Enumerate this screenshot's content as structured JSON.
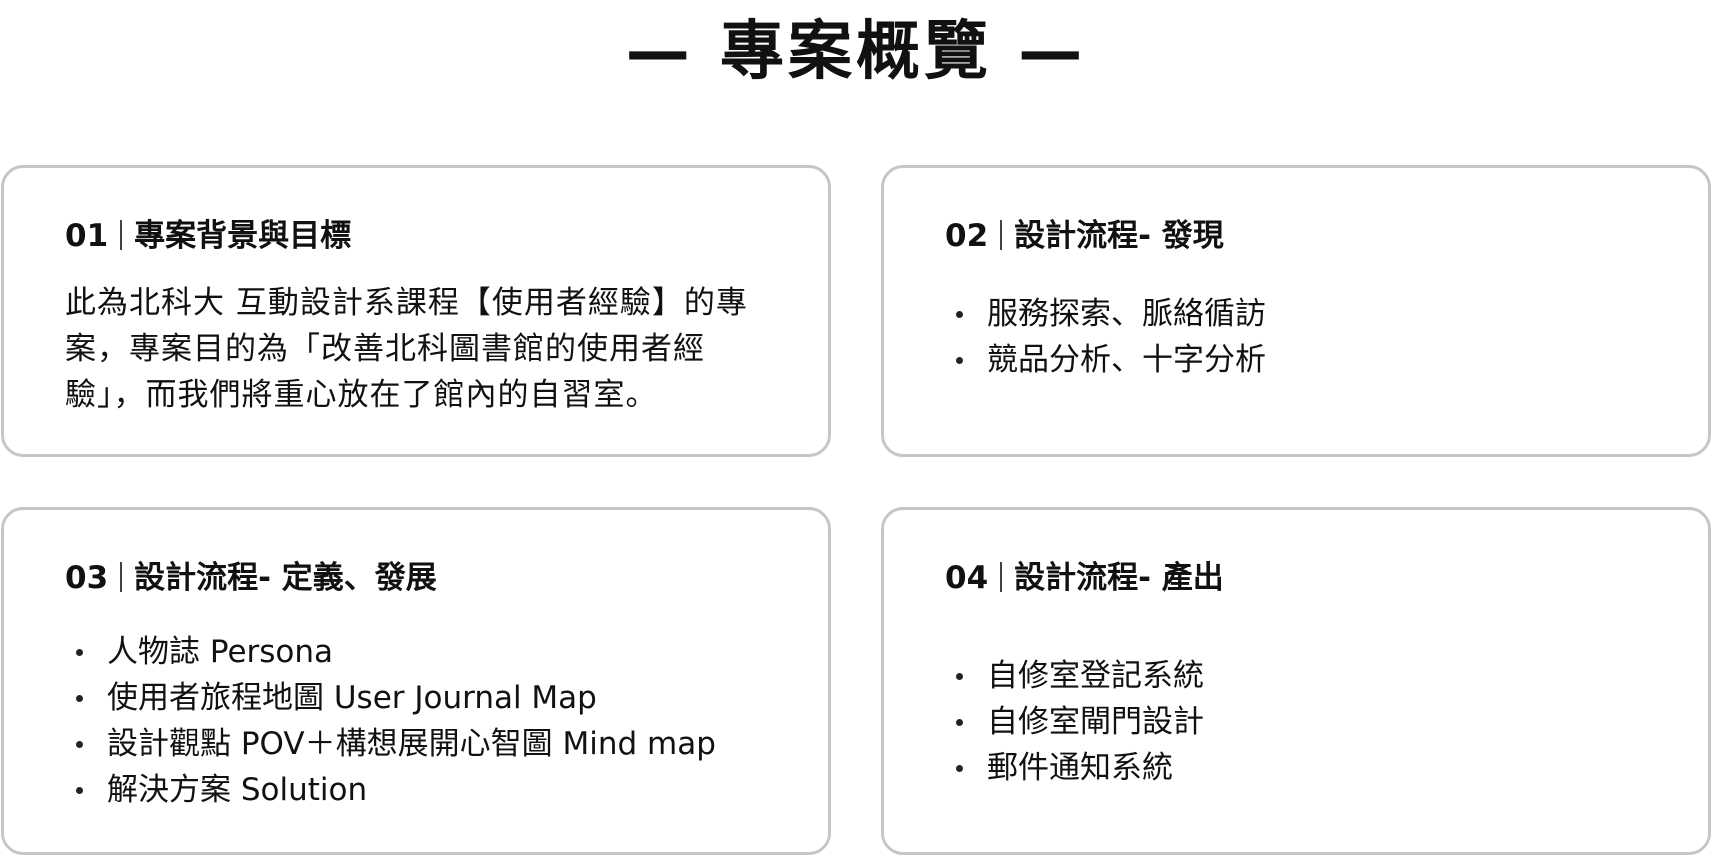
{
  "page": {
    "title": "— 專案概覽 —"
  },
  "cards": [
    {
      "number": "01",
      "title": "專案背景與目標",
      "paragraph": "此為北科大 互動設計系課程【使用者經驗】的專案，專案目的為「改善北科圖書館的使用者經驗」，而我們將重心放在了館內的自習室。"
    },
    {
      "number": "02",
      "title": "設計流程- 發現",
      "items": [
        "服務探索、脈絡循訪",
        "競品分析、十字分析"
      ]
    },
    {
      "number": "03",
      "title": "設計流程- 定義、發展",
      "items": [
        "人物誌 Persona",
        "使用者旅程地圖 User Journal Map",
        "設計觀點 POV＋構想展開心智圖 Mind map",
        "解決方案 Solution"
      ]
    },
    {
      "number": "04",
      "title": "設計流程- 產出",
      "items": [
        "自修室登記系統",
        "自修室閘門設計",
        "郵件通知系統"
      ]
    }
  ],
  "colors": {
    "card_border": "#c6c6c6",
    "text": "#111111",
    "background": "#ffffff"
  }
}
